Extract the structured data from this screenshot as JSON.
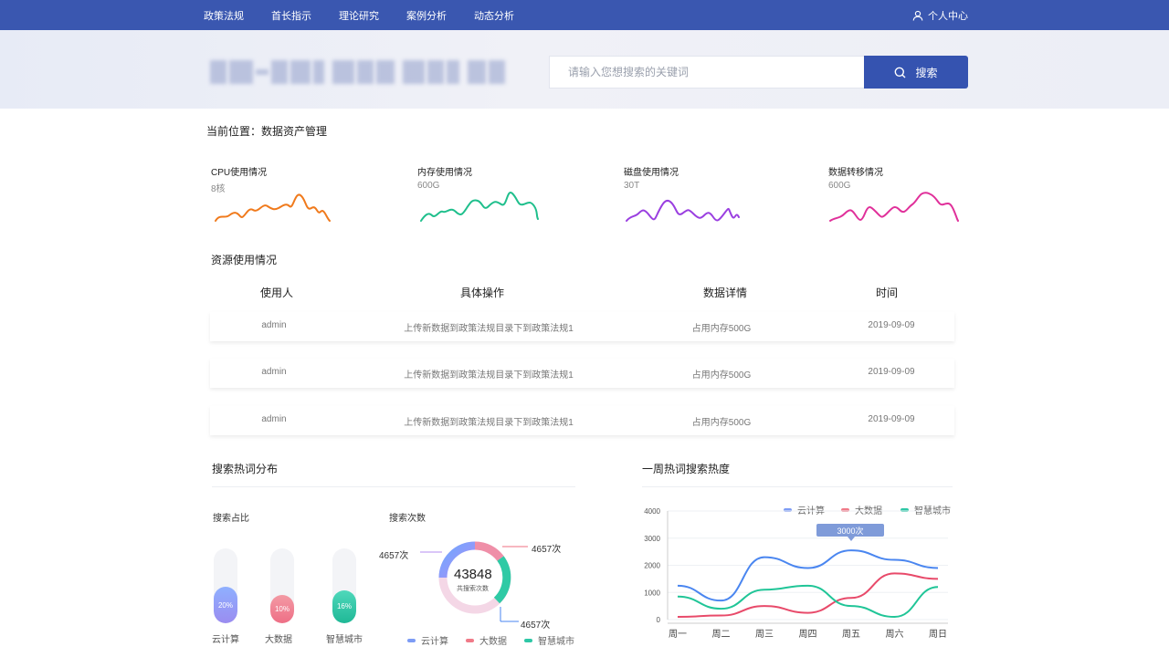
{
  "nav": {
    "items": [
      "政策法规",
      "首长指示",
      "理论研究",
      "案例分析",
      "动态分析"
    ],
    "user_center": "个人中心"
  },
  "search": {
    "placeholder": "请输入您想搜索的关键词",
    "button": "搜索"
  },
  "breadcrumb": "当前位置：数据资产管理",
  "stats": [
    {
      "title": "CPU使用情况",
      "value": "8核",
      "color": "#f07a1c"
    },
    {
      "title": "内存使用情况",
      "value": "600G",
      "color": "#1fbf8c"
    },
    {
      "title": "磁盘使用情况",
      "value": "30T",
      "color": "#9a3fe0"
    },
    {
      "title": "数据转移情况",
      "value": "600G",
      "color": "#e0309a"
    }
  ],
  "resource": {
    "title": "资源使用情况",
    "headers": [
      "使用人",
      "具体操作",
      "数据详情",
      "时间"
    ],
    "rows": [
      [
        "admin",
        "上传新数据到政策法规目录下到政策法规1",
        "占用内存500G",
        "2019-09-09"
      ],
      [
        "admin",
        "上传新数据到政策法规目录下到政策法规1",
        "占用内存500G",
        "2019-09-09"
      ],
      [
        "admin",
        "上传新数据到政策法规目录下到政策法规1",
        "占用内存500G",
        "2019-09-09"
      ]
    ]
  },
  "hot": {
    "title": "搜索热词分布",
    "ratio_title": "搜索占比",
    "count_title": "搜索次数",
    "bars": [
      {
        "label": "云计算",
        "percent": "20%",
        "value": 20,
        "color": "#7d9cf5"
      },
      {
        "label": "大数据",
        "percent": "10%",
        "value": 10,
        "color": "#f07a88"
      },
      {
        "label": "智慧城市",
        "percent": "16%",
        "value": 16,
        "color": "#2ec7a6"
      }
    ],
    "donut": {
      "total": "43848",
      "total_label": "共搜索次数",
      "callouts": [
        "4657次",
        "4657次",
        "4657次"
      ]
    },
    "legend": [
      "云计算",
      "大数据",
      "智慧城市"
    ]
  },
  "weekly": {
    "title": "一周热词搜索热度",
    "tooltip": "3000次",
    "chart_data": {
      "type": "line",
      "categories": [
        "周一",
        "周二",
        "周三",
        "周四",
        "周五",
        "周六",
        "周日"
      ],
      "ylim": [
        0,
        4000
      ],
      "yticks": [
        "4000",
        "3000",
        "2000",
        "1000",
        "0"
      ],
      "series": [
        {
          "name": "云计算",
          "color": "#4a86f0",
          "values": [
            1250,
            700,
            2300,
            1900,
            2550,
            2200,
            1900
          ]
        },
        {
          "name": "大数据",
          "color": "#e84a6a",
          "values": [
            100,
            150,
            500,
            250,
            800,
            1700,
            1500
          ]
        },
        {
          "name": "智慧城市",
          "color": "#20c597",
          "values": [
            850,
            400,
            1100,
            1250,
            500,
            100,
            1200
          ]
        }
      ]
    }
  }
}
